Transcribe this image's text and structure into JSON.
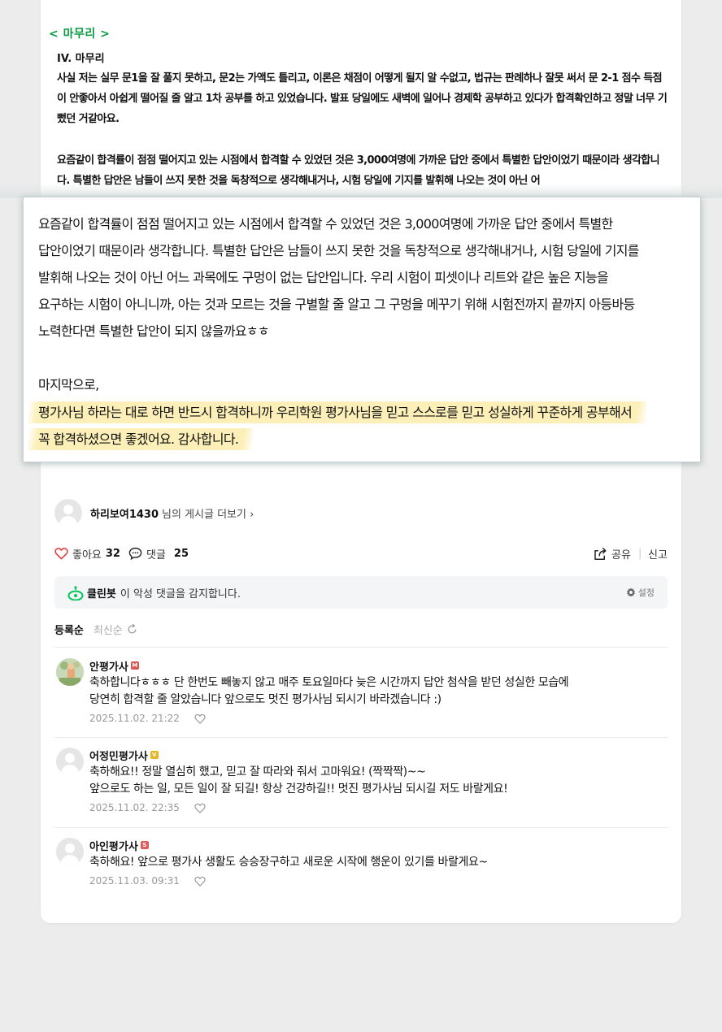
{
  "article": {
    "section_tag": "< 마무리 >",
    "heading": "IV. 마무리",
    "para1": "사실 저는 실무 문1을 잘 풀지 못하고, 문2는 가액도 틀리고, 이론은 채점이 어떻게 될지 알 수없고, 법규는 판례하나 잘못 써서 문 2-1 점수 득점이 안좋아서 아쉽게 떨어질 줄 알고 1차 공부를 하고 있었습니다. 발표 당일에도 새벽에 일어나 경제학 공부하고 있다가 합격확인하고 정말 너무 기뻤던 거같아요.",
    "para2": "요즘같이 합격률이 점점 떨어지고 있는 시점에서 합격할 수 있었던 것은 3,000여명에 가까운 답안 중에서 특별한 답안이었기 때문이라 생각합니다. 특별한 답안은 남들이 쓰지 못한 것을 독창적으로 생각해내거나, 시험 당일에 기지를 발휘해 나오는 것이 아닌 어"
  },
  "zoom": {
    "lines": [
      "요즘같이 합격률이 점점 떨어지고 있는 시점에서 합격할 수 있었던 것은 3,000여명에 가까운 답안 중에서 특별한",
      "답안이었기 때문이라 생각합니다. 특별한 답안은 남들이 쓰지 못한 것을 독창적으로 생각해내거나, 시험 당일에 기지를",
      "발휘해 나오는 것이 아닌 어느 과목에도 구멍이 없는 답안입니다. 우리 시험이 피셋이나 리트와 같은 높은 지능을",
      "요구하는 시험이 아니니까, 아는 것과 모르는 것을 구별할 줄 알고 그 구멍을 메꾸기 위해 시험전까지 끝까지 아등바등",
      "노력한다면 특별한 답안이 되지 않을까요ㅎㅎ"
    ],
    "closing_intro": "마지막으로,",
    "highlight_lines": [
      "평가사님 하라는 대로 하면 반드시 합격하니까 우리학원 평가사님을 믿고 스스로를 믿고 성실하게 꾸준하게 공부해서",
      "꼭 합격하셨으면 좋겠어요. 감사합니다."
    ],
    "highlight_color": "#fcefb8"
  },
  "author": {
    "name": "하리보여1430",
    "more": "님의 게시글 더보기 ›"
  },
  "actions": {
    "like_label": "좋아요",
    "like_count": "32",
    "comment_label": "댓글",
    "comment_count": "25",
    "share_label": "공유",
    "report_label": "신고"
  },
  "cleanbot": {
    "name": "클린봇",
    "text": "이 악성 댓글을 감지합니다.",
    "settings": "설정",
    "icon": "cleanbot-icon",
    "accent": "#03c75a"
  },
  "sort": {
    "registered": "등록순",
    "latest": "최신순"
  },
  "comments": [
    {
      "nick": "안평가사",
      "badge": "M",
      "badge_color": "#d9534f",
      "lines": [
        "축하합니다ㅎㅎㅎ 단 한번도 빼놓지 않고 매주 토요일마다 늦은 시간까지 답안 첨삭을 받던 성실한 모습에",
        "당연히 합격할 줄 알았습니다 앞으로도 멋진 평가사님 되시기 바라겠습니다 :)"
      ],
      "date": "2025.11.02. 21:22"
    },
    {
      "nick": "어정민평가사",
      "badge": "V",
      "badge_color": "#e6b422",
      "lines": [
        "축하해요!! 정말 열심히 했고, 믿고 잘 따라와 줘서 고마워요! (짝짝짝)~~",
        "앞으로도 하는 일, 모든 일이 잘 되길! 항상 건강하길!! 멋진 평가사님 되시길 저도 바랄게요!"
      ],
      "date": "2025.11.02. 22:35"
    },
    {
      "nick": "아인평가사",
      "badge": "S",
      "badge_color": "#e05a5a",
      "lines": [
        "축하해요! 앞으로 평가사 생활도 승승장구하고 새로운 시작에 행운이 있기를 바랄게요~"
      ],
      "date": "2025.11.03. 09:31"
    }
  ]
}
